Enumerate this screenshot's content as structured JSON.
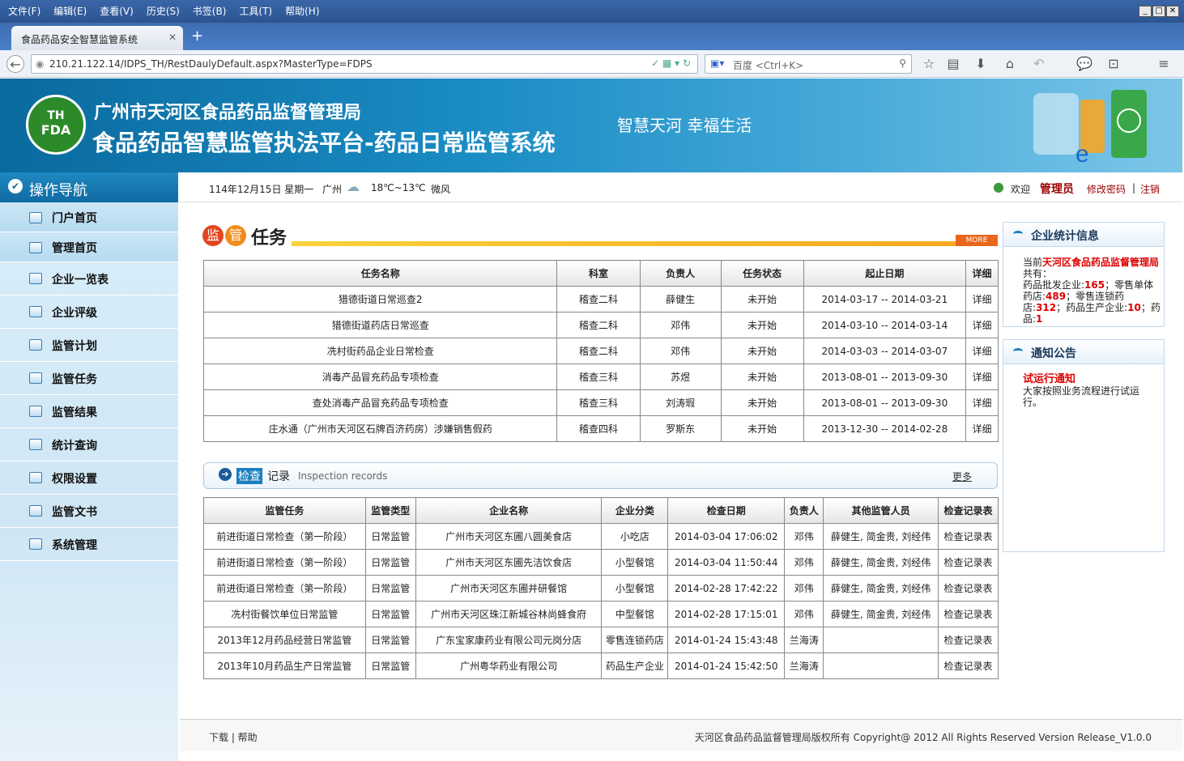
{
  "browser": {
    "menu": [
      "文件(F)",
      "编辑(E)",
      "查看(V)",
      "历史(S)",
      "书签(B)",
      "工具(T)",
      "帮助(H)"
    ],
    "tab_title": "食品药品安全智慧监管系统",
    "url": "210.21.122.14/IDPS_TH/RestDaulyDefault.aspx?MasterType=FDPS",
    "search_placeholder": "百度 <Ctrl+K>"
  },
  "header": {
    "logo_top": "TH",
    "logo_bottom": "FDA",
    "org": "广州市天河区食品药品监督管理局",
    "system": "食品药品智慧监管执法平台-药品日常监管系统",
    "slogan": "智慧天河 幸福生活"
  },
  "sidebar": {
    "title": "操作导航",
    "items": [
      "门户首页",
      "管理首页",
      "企业一览表",
      "企业评级",
      "监管计划",
      "监管任务",
      "监管结果",
      "统计查询",
      "权限设置",
      "监管文书",
      "系统管理"
    ]
  },
  "topinfo": {
    "date": "114年12月15日 星期一",
    "city": "广州",
    "temp": "18℃~13℃",
    "wind": "微风",
    "welcome": "欢迎",
    "user": "管理员",
    "change_pwd": "修改密码",
    "sep": "|",
    "logout": "注销"
  },
  "tasks": {
    "title_a": "监",
    "title_b": "管",
    "title_c": "任务",
    "more": "MORE",
    "headers": [
      "任务名称",
      "科室",
      "负责人",
      "任务状态",
      "起止日期",
      "详细"
    ],
    "rows": [
      [
        "猎德街道日常巡查2",
        "稽查二科",
        "薛健生",
        "未开始",
        "2014-03-17 -- 2014-03-21",
        "详细"
      ],
      [
        "猎德街道药店日常巡查",
        "稽查二科",
        "邓伟",
        "未开始",
        "2014-03-10 -- 2014-03-14",
        "详细"
      ],
      [
        "冼村街药品企业日常检查",
        "稽查二科",
        "邓伟",
        "未开始",
        "2014-03-03 -- 2014-03-07",
        "详细"
      ],
      [
        "消毒产品冒充药品专项检查",
        "稽查三科",
        "苏煜",
        "未开始",
        "2013-08-01 -- 2013-09-30",
        "详细"
      ],
      [
        "查处消毒产品冒充药品专项检查",
        "稽查三科",
        "刘涛瑕",
        "未开始",
        "2013-08-01 -- 2013-09-30",
        "详细"
      ],
      [
        "庄水通（广州市天河区石牌百济药房）涉嫌销售假药",
        "稽查四科",
        "罗斯东",
        "未开始",
        "2013-12-30 -- 2014-02-28",
        "详细"
      ]
    ]
  },
  "records": {
    "title_a": "检查",
    "title_b": "记录",
    "subtitle": "Inspection records",
    "more": "更多",
    "headers": [
      "监管任务",
      "监管类型",
      "企业名称",
      "企业分类",
      "检查日期",
      "负责人",
      "其他监管人员",
      "检查记录表"
    ],
    "rows": [
      [
        "前进街道日常检查（第一阶段）",
        "日常监管",
        "广州市天河区东圃八圆美食店",
        "小吃店",
        "2014-03-04 17:06:02",
        "邓伟",
        "薛健生, 简金贵, 刘经伟",
        "检查记录表"
      ],
      [
        "前进街道日常检查（第一阶段）",
        "日常监管",
        "广州市天河区东圃先洁饮食店",
        "小型餐馆",
        "2014-03-04 11:50:44",
        "邓伟",
        "薛健生, 简金贵, 刘经伟",
        "检查记录表"
      ],
      [
        "前进街道日常检查（第一阶段）",
        "日常监管",
        "广州市天河区东圃井研餐馆",
        "小型餐馆",
        "2014-02-28 17:42:22",
        "邓伟",
        "薛健生, 简金贵, 刘经伟",
        "检查记录表"
      ],
      [
        "冼村街餐饮单位日常监管",
        "日常监管",
        "广州市天河区珠江新城谷林尚蜂食府",
        "中型餐馆",
        "2014-02-28 17:15:01",
        "邓伟",
        "薛健生, 简金贵, 刘经伟",
        "检查记录表"
      ],
      [
        "2013年12月药品经营日常监管",
        "日常监管",
        "广东宝家康药业有限公司元岗分店",
        "零售连锁药店",
        "2014-01-24 15:43:48",
        "兰海涛",
        "",
        "检查记录表"
      ],
      [
        "2013年10月药品生产日常监管",
        "日常监管",
        "广州粤华药业有限公司",
        "药品生产企业",
        "2014-01-24 15:42:50",
        "兰海涛",
        "",
        "检查记录表"
      ]
    ]
  },
  "stats": {
    "title": "企业统计信息",
    "prefix": "当前",
    "org": "天河区食品药品监督管理局",
    "has": "共有：",
    "l1": "药品批发企业:",
    "v1": "165",
    "l2": "；零售单体药店:",
    "v2": "489",
    "l3": "；零售连锁药店:",
    "v3": "312",
    "l4": "；药品生产企业:",
    "v4": "10",
    "l5": "；药品:",
    "v5": "1"
  },
  "notice": {
    "title": "通知公告",
    "item_title": "试运行通知",
    "item_body": "大家按照业务流程进行试运行。"
  },
  "footer": {
    "links": "下载 | 帮助",
    "copyright": "天河区食品药品监督管理局版权所有 Copyright@ 2012 All Rights Reserved Version Release_V1.0.0"
  }
}
